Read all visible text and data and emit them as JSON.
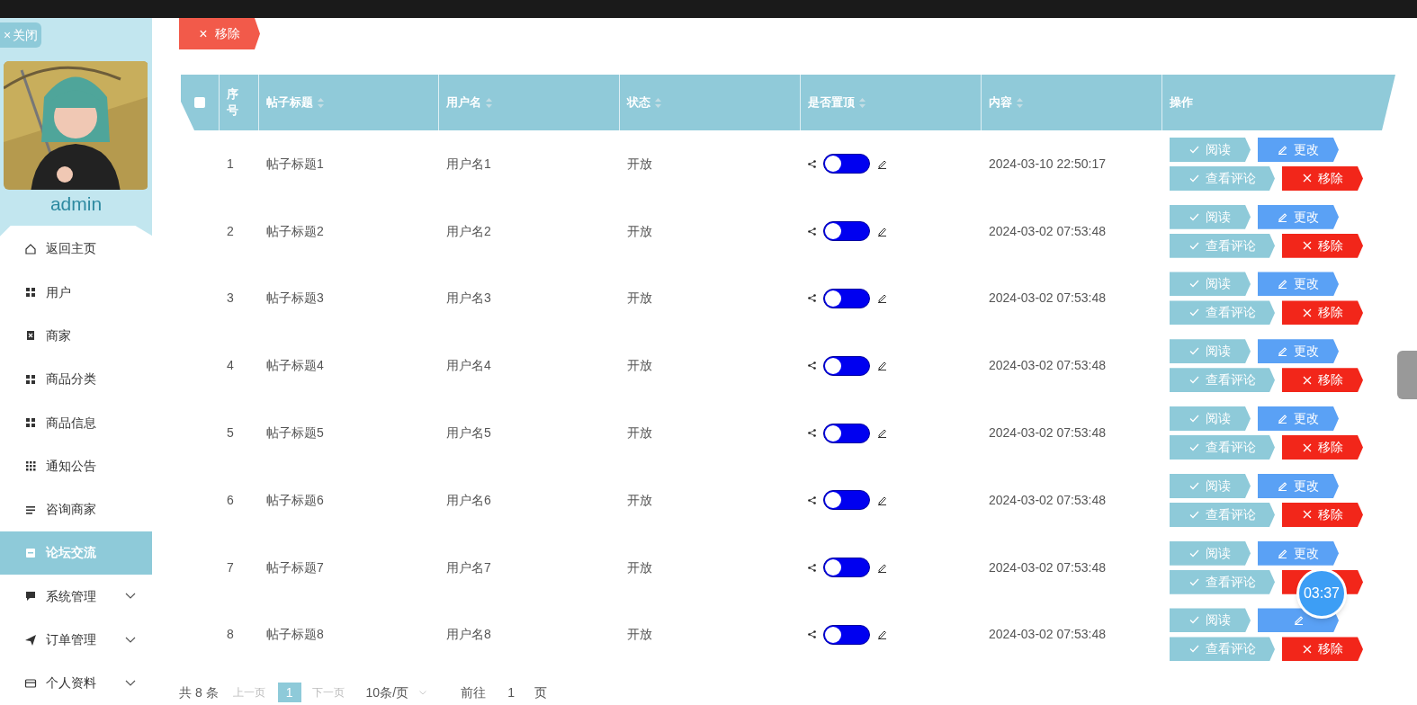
{
  "close_button": {
    "icon": "×",
    "label": "关闭"
  },
  "user": {
    "name": "admin"
  },
  "menu": [
    {
      "label": "返回主页",
      "selected": false,
      "expandable": false
    },
    {
      "label": "用户",
      "selected": false,
      "expandable": false
    },
    {
      "label": "商家",
      "selected": false,
      "expandable": false
    },
    {
      "label": "商品分类",
      "selected": false,
      "expandable": false
    },
    {
      "label": "商品信息",
      "selected": false,
      "expandable": false
    },
    {
      "label": "通知公告",
      "selected": false,
      "expandable": false
    },
    {
      "label": "咨询商家",
      "selected": false,
      "expandable": false
    },
    {
      "label": "论坛交流",
      "selected": true,
      "expandable": false
    },
    {
      "label": "系统管理",
      "selected": false,
      "expandable": true
    },
    {
      "label": "订单管理",
      "selected": false,
      "expandable": true
    },
    {
      "label": "个人资料",
      "selected": false,
      "expandable": true
    }
  ],
  "toolbar": {
    "remove_button": {
      "icon": "×",
      "label": "移除"
    }
  },
  "table": {
    "select_all": {
      "checked": false
    },
    "columns": [
      {
        "label": "序号",
        "sortable": false
      },
      {
        "label": "帖子标题",
        "sortable": true
      },
      {
        "label": "用户名",
        "sortable": true
      },
      {
        "label": "状态",
        "sortable": true
      },
      {
        "label": "是否置顶",
        "sortable": true
      },
      {
        "label": "内容",
        "sortable": true
      },
      {
        "label": "操作",
        "sortable": false
      }
    ],
    "rows": [
      {
        "index": "1",
        "title": "帖子标题1",
        "username": "用户名1",
        "status": "开放",
        "pinned": {
          "on": false
        },
        "content": "2024-03-10 22:50:17",
        "actions": [
          {
            "kind": "read",
            "label": "阅读"
          },
          {
            "kind": "edit",
            "label": "更改"
          },
          {
            "kind": "comments",
            "label": "查看评论"
          },
          {
            "kind": "remove",
            "label": "移除"
          }
        ]
      },
      {
        "index": "2",
        "title": "帖子标题2",
        "username": "用户名2",
        "status": "开放",
        "pinned": {
          "on": false
        },
        "content": "2024-03-02 07:53:48",
        "actions": [
          {
            "kind": "read",
            "label": "阅读"
          },
          {
            "kind": "edit",
            "label": "更改"
          },
          {
            "kind": "comments",
            "label": "查看评论"
          },
          {
            "kind": "remove",
            "label": "移除"
          }
        ]
      },
      {
        "index": "3",
        "title": "帖子标题3",
        "username": "用户名3",
        "status": "开放",
        "pinned": {
          "on": false
        },
        "content": "2024-03-02 07:53:48",
        "actions": [
          {
            "kind": "read",
            "label": "阅读"
          },
          {
            "kind": "edit",
            "label": "更改"
          },
          {
            "kind": "comments",
            "label": "查看评论"
          },
          {
            "kind": "remove",
            "label": "移除"
          }
        ]
      },
      {
        "index": "4",
        "title": "帖子标题4",
        "username": "用户名4",
        "status": "开放",
        "pinned": {
          "on": false
        },
        "content": "2024-03-02 07:53:48",
        "actions": [
          {
            "kind": "read",
            "label": "阅读"
          },
          {
            "kind": "edit",
            "label": "更改"
          },
          {
            "kind": "comments",
            "label": "查看评论"
          },
          {
            "kind": "remove",
            "label": "移除"
          }
        ]
      },
      {
        "index": "5",
        "title": "帖子标题5",
        "username": "用户名5",
        "status": "开放",
        "pinned": {
          "on": false
        },
        "content": "2024-03-02 07:53:48",
        "actions": [
          {
            "kind": "read",
            "label": "阅读"
          },
          {
            "kind": "edit",
            "label": "更改"
          },
          {
            "kind": "comments",
            "label": "查看评论"
          },
          {
            "kind": "remove",
            "label": "移除"
          }
        ]
      },
      {
        "index": "6",
        "title": "帖子标题6",
        "username": "用户名6",
        "status": "开放",
        "pinned": {
          "on": false
        },
        "content": "2024-03-02 07:53:48",
        "actions": [
          {
            "kind": "read",
            "label": "阅读"
          },
          {
            "kind": "edit",
            "label": "更改"
          },
          {
            "kind": "comments",
            "label": "查看评论"
          },
          {
            "kind": "remove",
            "label": "移除"
          }
        ]
      },
      {
        "index": "7",
        "title": "帖子标题7",
        "username": "用户名7",
        "status": "开放",
        "pinned": {
          "on": false
        },
        "content": "2024-03-02 07:53:48",
        "actions": [
          {
            "kind": "read",
            "label": "阅读"
          },
          {
            "kind": "edit",
            "label": "更改"
          },
          {
            "kind": "comments",
            "label": "查看评论"
          },
          {
            "kind": "remove"
          }
        ]
      },
      {
        "index": "8",
        "title": "帖子标题8",
        "username": "用户名8",
        "status": "开放",
        "pinned": {
          "on": false
        },
        "content": "2024-03-02 07:53:48",
        "actions": [
          {
            "kind": "read",
            "label": "阅读"
          },
          {
            "kind": "edit"
          },
          {
            "kind": "comments",
            "label": "查看评论"
          },
          {
            "kind": "remove",
            "label": "移除"
          }
        ]
      }
    ]
  },
  "pagination": {
    "total": "共 8 条",
    "prev": "上一页",
    "pages": [
      {
        "label": "1",
        "selected": true
      }
    ],
    "next": "下一页",
    "page_size": "10条/页",
    "goto_label": "前往",
    "goto_value": "1",
    "goto_suffix": "页"
  },
  "timer": "03:37"
}
